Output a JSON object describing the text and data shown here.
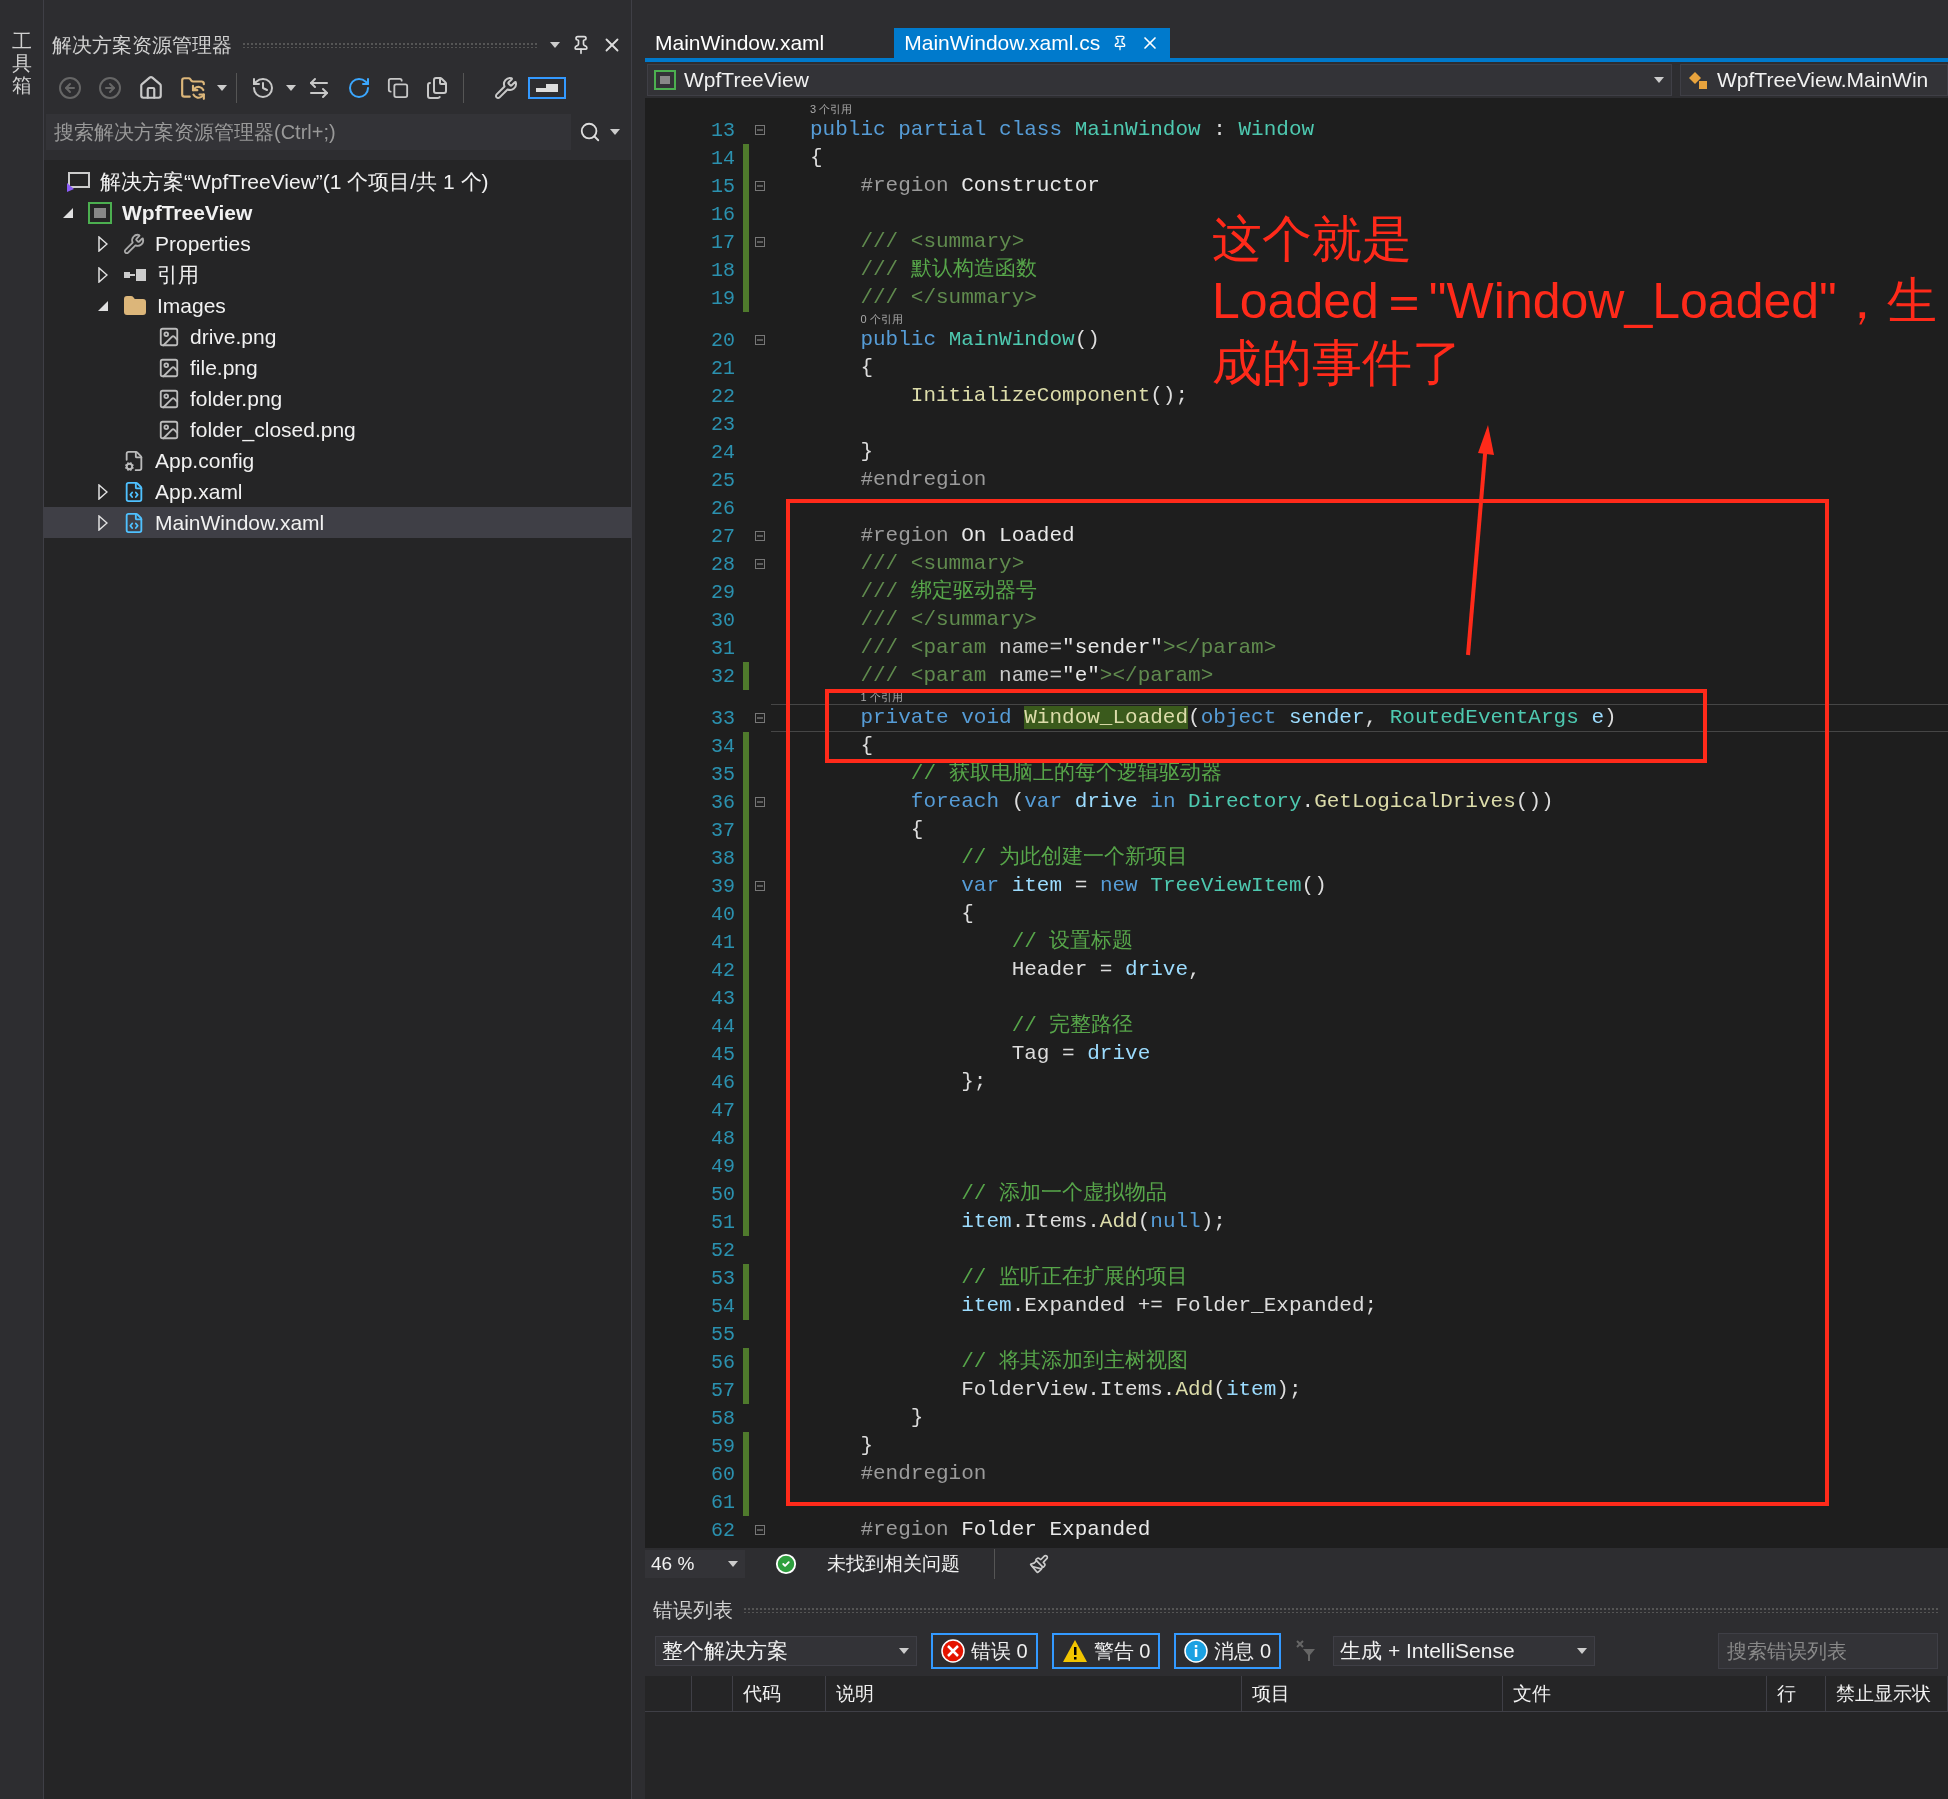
{
  "toolbox_tab": {
    "label": "工具箱"
  },
  "solution_explorer": {
    "title": "解决方案资源管理器",
    "preview_selected": true,
    "search": {
      "placeholder": "搜索解决方案资源管理器(Ctrl+;)"
    },
    "tree": [
      {
        "label": "解决方案“WpfTreeView”(1 个项目/共 1 个)",
        "kind": "solution",
        "selected": false,
        "children": [
          {
            "label": "WpfTreeView",
            "kind": "project",
            "bold": true,
            "expanded": true,
            "selected": false,
            "children": [
              {
                "label": "Properties",
                "kind": "properties",
                "expanded": false,
                "selected": false
              },
              {
                "label": "引用",
                "kind": "references",
                "expanded": false,
                "selected": false
              },
              {
                "label": "Images",
                "kind": "folder",
                "expanded": true,
                "selected": false,
                "children": [
                  {
                    "label": "drive.png",
                    "kind": "image",
                    "selected": false
                  },
                  {
                    "label": "file.png",
                    "kind": "image",
                    "selected": false
                  },
                  {
                    "label": "folder.png",
                    "kind": "image",
                    "selected": false
                  },
                  {
                    "label": "folder_closed.png",
                    "kind": "image",
                    "selected": false
                  }
                ]
              },
              {
                "label": "App.config",
                "kind": "config",
                "selected": false
              },
              {
                "label": "App.xaml",
                "kind": "xaml",
                "expanded": false,
                "selected": false
              },
              {
                "label": "MainWindow.xaml",
                "kind": "xaml",
                "expanded": false,
                "selected": true
              }
            ]
          }
        ]
      }
    ]
  },
  "editor": {
    "tabs": [
      {
        "label": "MainWindow.xaml",
        "selected": false
      },
      {
        "label": "MainWindow.xaml.cs",
        "selected": true
      }
    ],
    "nav": {
      "project": "WpfTreeView",
      "member": "WpfTreeView.MainWin"
    },
    "lines": [
      {
        "number": "13",
        "lens": "3 个引用",
        "changed": false,
        "foldable": true,
        "current": false,
        "tokens": [
          {
            "kind": "keyword",
            "text": "public partial class "
          },
          {
            "kind": "type",
            "text": "MainWindow"
          },
          {
            "kind": "plain",
            "text": " : "
          },
          {
            "kind": "type",
            "text": "Window"
          }
        ]
      },
      {
        "number": "14",
        "changed": true,
        "foldable": false,
        "current": false,
        "tokens": [
          {
            "kind": "plain",
            "text": "{"
          }
        ]
      },
      {
        "number": "15",
        "changed": true,
        "foldable": true,
        "current": false,
        "tokens": [
          {
            "kind": "region",
            "text": "    #region "
          },
          {
            "kind": "region-name",
            "text": "Constructor"
          }
        ]
      },
      {
        "number": "16",
        "changed": true,
        "foldable": false,
        "current": false
      },
      {
        "number": "17",
        "changed": true,
        "foldable": true,
        "current": false,
        "tokens": [
          {
            "kind": "doc",
            "text": "    /// <summary>"
          }
        ]
      },
      {
        "number": "18",
        "changed": true,
        "foldable": false,
        "current": false,
        "tokens": [
          {
            "kind": "doc",
            "text": "    /// "
          },
          {
            "kind": "comment",
            "text": "默认构造函数"
          }
        ]
      },
      {
        "number": "19",
        "changed": true,
        "foldable": false,
        "current": false,
        "tokens": [
          {
            "kind": "doc",
            "text": "    /// </summary>"
          }
        ]
      },
      {
        "number": "20",
        "lens": "0 个引用",
        "changed": false,
        "foldable": true,
        "current": false,
        "tokens": [
          {
            "kind": "keyword",
            "text": "    public "
          },
          {
            "kind": "type",
            "text": "MainWindow"
          },
          {
            "kind": "plain",
            "text": "()"
          }
        ]
      },
      {
        "number": "21",
        "changed": false,
        "foldable": false,
        "current": false,
        "tokens": [
          {
            "kind": "plain",
            "text": "    {"
          }
        ]
      },
      {
        "number": "22",
        "changed": false,
        "foldable": false,
        "current": false,
        "tokens": [
          {
            "kind": "method",
            "text": "        InitializeComponent"
          },
          {
            "kind": "plain",
            "text": "();"
          }
        ]
      },
      {
        "number": "23",
        "changed": false,
        "foldable": false,
        "current": false
      },
      {
        "number": "24",
        "changed": false,
        "foldable": false,
        "current": false,
        "tokens": [
          {
            "kind": "plain",
            "text": "    }"
          }
        ]
      },
      {
        "number": "25",
        "changed": false,
        "foldable": false,
        "current": false,
        "tokens": [
          {
            "kind": "region",
            "text": "    #endregion"
          }
        ]
      },
      {
        "number": "26",
        "changed": false,
        "foldable": false,
        "current": false
      },
      {
        "number": "27",
        "changed": false,
        "foldable": true,
        "current": false,
        "tokens": [
          {
            "kind": "region",
            "text": "    #region "
          },
          {
            "kind": "region-name",
            "text": "On Loaded"
          }
        ]
      },
      {
        "number": "28",
        "changed": false,
        "foldable": true,
        "current": false,
        "tokens": [
          {
            "kind": "doc",
            "text": "    /// <summary>"
          }
        ]
      },
      {
        "number": "29",
        "changed": false,
        "foldable": false,
        "current": false,
        "tokens": [
          {
            "kind": "doc",
            "text": "    /// "
          },
          {
            "kind": "comment",
            "text": "绑定驱动器号"
          }
        ]
      },
      {
        "number": "30",
        "changed": false,
        "foldable": false,
        "current": false,
        "tokens": [
          {
            "kind": "doc",
            "text": "    /// </summary>"
          }
        ]
      },
      {
        "number": "31",
        "changed": false,
        "foldable": false,
        "current": false,
        "tokens": [
          {
            "kind": "doc",
            "text": "    /// <param "
          },
          {
            "kind": "doc-attr",
            "text": "name="
          },
          {
            "kind": "doc-value",
            "text": "\"sender\""
          },
          {
            "kind": "doc",
            "text": "></param>"
          }
        ]
      },
      {
        "number": "32",
        "changed": true,
        "foldable": false,
        "current": false,
        "tokens": [
          {
            "kind": "doc",
            "text": "    /// <param "
          },
          {
            "kind": "doc-attr",
            "text": "name="
          },
          {
            "kind": "doc-value",
            "text": "\"e\""
          },
          {
            "kind": "doc",
            "text": "></param>"
          }
        ]
      },
      {
        "number": "33",
        "lens": "1 个引用",
        "changed": false,
        "foldable": true,
        "current": true,
        "tokens": [
          {
            "kind": "keyword",
            "text": "    private void "
          },
          {
            "kind": "highlight",
            "text": "Window_Loaded"
          },
          {
            "kind": "plain",
            "text": "("
          },
          {
            "kind": "keyword",
            "text": "object "
          },
          {
            "kind": "variable",
            "text": "sender"
          },
          {
            "kind": "plain",
            "text": ", "
          },
          {
            "kind": "type",
            "text": "RoutedEventArgs "
          },
          {
            "kind": "variable",
            "text": "e"
          },
          {
            "kind": "plain",
            "text": ")"
          }
        ]
      },
      {
        "number": "34",
        "changed": true,
        "foldable": false,
        "current": false,
        "tokens": [
          {
            "kind": "plain",
            "text": "    {"
          }
        ]
      },
      {
        "number": "35",
        "changed": true,
        "foldable": false,
        "current": false,
        "tokens": [
          {
            "kind": "comment",
            "text": "        // 获取电脑上的每个逻辑驱动器"
          }
        ]
      },
      {
        "number": "36",
        "changed": true,
        "foldable": true,
        "current": false,
        "tokens": [
          {
            "kind": "keyword",
            "text": "        foreach "
          },
          {
            "kind": "plain",
            "text": "("
          },
          {
            "kind": "keyword",
            "text": "var "
          },
          {
            "kind": "variable",
            "text": "drive "
          },
          {
            "kind": "keyword",
            "text": "in "
          },
          {
            "kind": "type",
            "text": "Directory"
          },
          {
            "kind": "plain",
            "text": "."
          },
          {
            "kind": "method",
            "text": "GetLogicalDrives"
          },
          {
            "kind": "plain",
            "text": "())"
          }
        ]
      },
      {
        "number": "37",
        "changed": true,
        "foldable": false,
        "current": false,
        "tokens": [
          {
            "kind": "plain",
            "text": "        {"
          }
        ]
      },
      {
        "number": "38",
        "changed": true,
        "foldable": false,
        "current": false,
        "tokens": [
          {
            "kind": "comment",
            "text": "            // 为此创建一个新项目"
          }
        ]
      },
      {
        "number": "39",
        "changed": true,
        "foldable": true,
        "current": false,
        "tokens": [
          {
            "kind": "keyword",
            "text": "            var "
          },
          {
            "kind": "variable",
            "text": "item "
          },
          {
            "kind": "plain",
            "text": "= "
          },
          {
            "kind": "keyword",
            "text": "new "
          },
          {
            "kind": "type",
            "text": "TreeViewItem"
          },
          {
            "kind": "plain",
            "text": "()"
          }
        ]
      },
      {
        "number": "40",
        "changed": true,
        "foldable": false,
        "current": false,
        "tokens": [
          {
            "kind": "plain",
            "text": "            {"
          }
        ]
      },
      {
        "number": "41",
        "changed": true,
        "foldable": false,
        "current": false,
        "tokens": [
          {
            "kind": "comment",
            "text": "                // 设置标题"
          }
        ]
      },
      {
        "number": "42",
        "changed": true,
        "foldable": false,
        "current": false,
        "tokens": [
          {
            "kind": "plain",
            "text": "                Header = "
          },
          {
            "kind": "variable",
            "text": "drive"
          },
          {
            "kind": "plain",
            "text": ","
          }
        ]
      },
      {
        "number": "43",
        "changed": true,
        "foldable": false,
        "current": false
      },
      {
        "number": "44",
        "changed": true,
        "foldable": false,
        "current": false,
        "tokens": [
          {
            "kind": "comment",
            "text": "                // 完整路径"
          }
        ]
      },
      {
        "number": "45",
        "changed": true,
        "foldable": false,
        "current": false,
        "tokens": [
          {
            "kind": "plain",
            "text": "                Tag = "
          },
          {
            "kind": "variable",
            "text": "drive"
          }
        ]
      },
      {
        "number": "46",
        "changed": true,
        "foldable": false,
        "current": false,
        "tokens": [
          {
            "kind": "plain",
            "text": "            };"
          }
        ]
      },
      {
        "number": "47",
        "changed": true,
        "foldable": false,
        "current": false
      },
      {
        "number": "48",
        "changed": true,
        "foldable": false,
        "current": false
      },
      {
        "number": "49",
        "changed": true,
        "foldable": false,
        "current": false
      },
      {
        "number": "50",
        "changed": true,
        "foldable": false,
        "current": false,
        "tokens": [
          {
            "kind": "comment",
            "text": "            // 添加一个虚拟物品"
          }
        ]
      },
      {
        "number": "51",
        "changed": true,
        "foldable": false,
        "current": false,
        "tokens": [
          {
            "kind": "variable",
            "text": "            item"
          },
          {
            "kind": "plain",
            "text": ".Items."
          },
          {
            "kind": "method",
            "text": "Add"
          },
          {
            "kind": "plain",
            "text": "("
          },
          {
            "kind": "keyword",
            "text": "null"
          },
          {
            "kind": "plain",
            "text": ");"
          }
        ]
      },
      {
        "number": "52",
        "changed": false,
        "foldable": false,
        "current": false
      },
      {
        "number": "53",
        "changed": true,
        "foldable": false,
        "current": false,
        "tokens": [
          {
            "kind": "comment",
            "text": "            // 监听正在扩展的项目"
          }
        ]
      },
      {
        "number": "54",
        "changed": true,
        "foldable": false,
        "current": false,
        "tokens": [
          {
            "kind": "variable",
            "text": "            item"
          },
          {
            "kind": "plain",
            "text": ".Expanded += Folder_Expanded;"
          }
        ]
      },
      {
        "number": "55",
        "changed": false,
        "foldable": false,
        "current": false
      },
      {
        "number": "56",
        "changed": true,
        "foldable": false,
        "current": false,
        "tokens": [
          {
            "kind": "comment",
            "text": "            // 将其添加到主树视图"
          }
        ]
      },
      {
        "number": "57",
        "changed": true,
        "foldable": false,
        "current": false,
        "tokens": [
          {
            "kind": "plain",
            "text": "            FolderView.Items."
          },
          {
            "kind": "method",
            "text": "Add"
          },
          {
            "kind": "plain",
            "text": "("
          },
          {
            "kind": "variable",
            "text": "item"
          },
          {
            "kind": "plain",
            "text": ");"
          }
        ]
      },
      {
        "number": "58",
        "changed": false,
        "foldable": false,
        "current": false,
        "tokens": [
          {
            "kind": "plain",
            "text": "        }"
          }
        ]
      },
      {
        "number": "59",
        "changed": true,
        "foldable": false,
        "current": false,
        "tokens": [
          {
            "kind": "plain",
            "text": "    }"
          }
        ]
      },
      {
        "number": "60",
        "changed": true,
        "foldable": false,
        "current": false,
        "tokens": [
          {
            "kind": "region",
            "text": "    #endregion"
          }
        ]
      },
      {
        "number": "61",
        "changed": true,
        "foldable": false,
        "current": false
      },
      {
        "number": "62",
        "changed": false,
        "foldable": true,
        "current": false,
        "tokens": [
          {
            "kind": "region",
            "text": "    #region "
          },
          {
            "kind": "region-name",
            "text": "Folder Expanded"
          }
        ]
      }
    ],
    "annotation": {
      "lines": [
        "这个就是",
        "Loaded＝\"Window_Loaded\"，生",
        "成的事件了"
      ]
    },
    "status": {
      "zoom": "46 %",
      "issues": "未找到相关问题"
    }
  },
  "error_list": {
    "title": "错误列表",
    "scope": "整个解决方案",
    "filters": [
      {
        "kind": "error",
        "label": "错误 0",
        "selected": true
      },
      {
        "kind": "warning",
        "label": "警告 0",
        "selected": true
      },
      {
        "kind": "message",
        "label": "消息 0",
        "selected": true
      }
    ],
    "source": "生成 + IntelliSense",
    "search": {
      "placeholder": "搜索错误列表"
    },
    "columns": [
      "代码",
      "说明",
      "项目",
      "文件",
      "行",
      "禁止显示状"
    ]
  }
}
